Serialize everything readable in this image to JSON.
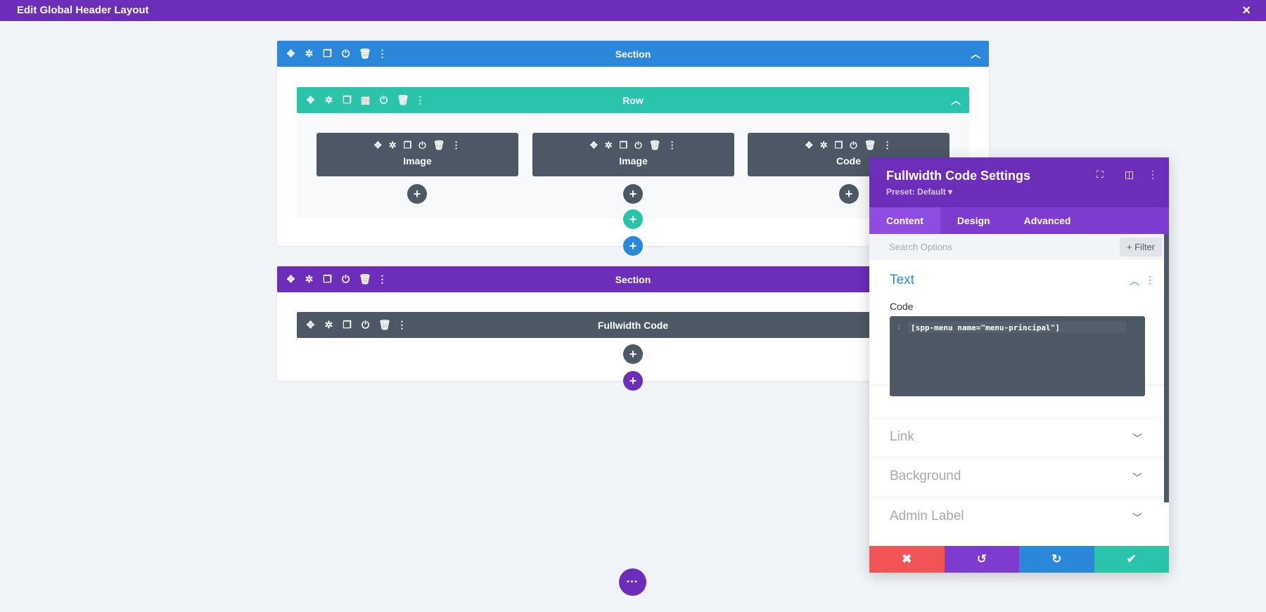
{
  "window": {
    "title": "Edit Global Header Layout",
    "close_icon": "×"
  },
  "toolbar_icons": {
    "move": "✥",
    "settings": "✲",
    "duplicate": "❐",
    "columns": "▥",
    "power": "⏻",
    "trash": "🗑",
    "more": "⋮"
  },
  "section1": {
    "label": "Section",
    "color": "#2b87da"
  },
  "row": {
    "label": "Row",
    "color": "#29c4a9"
  },
  "modules": [
    {
      "label": "Image"
    },
    {
      "label": "Image"
    },
    {
      "label": "Code"
    }
  ],
  "section2": {
    "label": "Section",
    "color": "#6c2eb9"
  },
  "fullwidth_module": {
    "label": "Fullwidth Code"
  },
  "plus": "+",
  "more_dots": "•••",
  "panel": {
    "title": "Fullwidth Code Settings",
    "preset": "Preset: Default ▾",
    "tabs": [
      "Content",
      "Design",
      "Advanced"
    ],
    "active_tab": "Content",
    "search_placeholder": "Search Options",
    "filter_label": "+ Filter",
    "text_section": {
      "title": "Text",
      "code_label": "Code",
      "line_number": "1",
      "code": "[spp-menu name=\"menu-principal\"]"
    },
    "collapsed_sections": [
      "Link",
      "Background",
      "Admin Label"
    ],
    "footer": {
      "cancel": "✖",
      "undo": "↺",
      "redo": "↻",
      "save": "✔"
    },
    "footer_colors": [
      "#ef5555",
      "#7e3bd0",
      "#2b87da",
      "#29c4a9"
    ]
  }
}
